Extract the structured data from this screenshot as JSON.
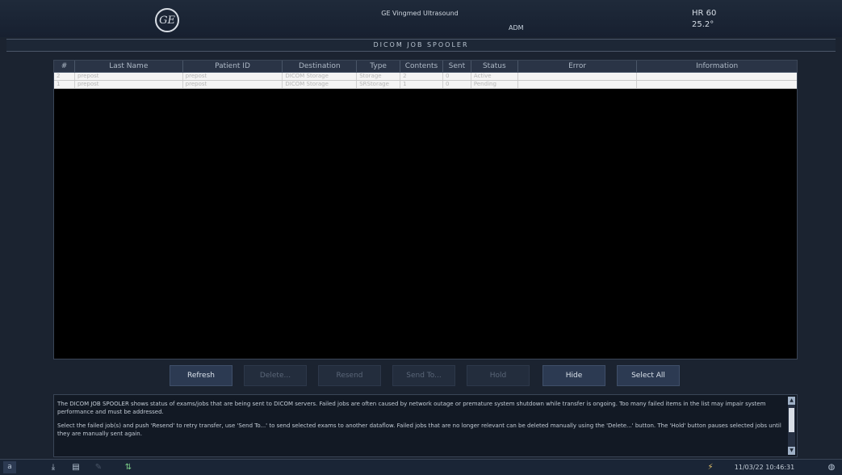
{
  "header": {
    "app_title": "GE Vingmed Ultrasound",
    "user": "ADM",
    "hr": "HR 60",
    "temp": "25.2°",
    "logo_text": "GE"
  },
  "window_title": "DICOM JOB SPOOLER",
  "table": {
    "columns": [
      "#",
      "Last Name",
      "Patient ID",
      "Destination",
      "Type",
      "Contents",
      "Sent",
      "Status",
      "Error",
      "Information"
    ],
    "rows": [
      [
        "2",
        "prepost",
        "prepost",
        "DICOM Storage",
        "Storage",
        "2",
        "0",
        "Active",
        "",
        ""
      ],
      [
        "1",
        "prepost",
        "prepost",
        "DICOM Storage",
        "SRStorage",
        "1",
        "0",
        "Pending",
        "",
        ""
      ]
    ]
  },
  "buttons": {
    "refresh": "Refresh",
    "delete": "Delete...",
    "resend": "Resend",
    "send_to": "Send To...",
    "hold": "Hold",
    "hide": "Hide",
    "select_all": "Select All"
  },
  "info": {
    "p1": "The DICOM JOB SPOOLER shows status of exams/jobs that are being sent to DICOM servers. Failed jobs are often caused by network outage or premature system shutdown while transfer is ongoing. Too many failed items in the list may impair system performance and must be addressed.",
    "p2": "Select the failed job(s) and push 'Resend' to retry transfer, use 'Send To...' to send selected exams to another dataflow. Failed jobs that are no longer relevant can be deleted manually using the 'Delete...' button. The 'Hold' button pauses selected jobs until they are manually sent again."
  },
  "taskbar": {
    "a_label": "a",
    "clock": "11/03/22 10:46:31"
  }
}
